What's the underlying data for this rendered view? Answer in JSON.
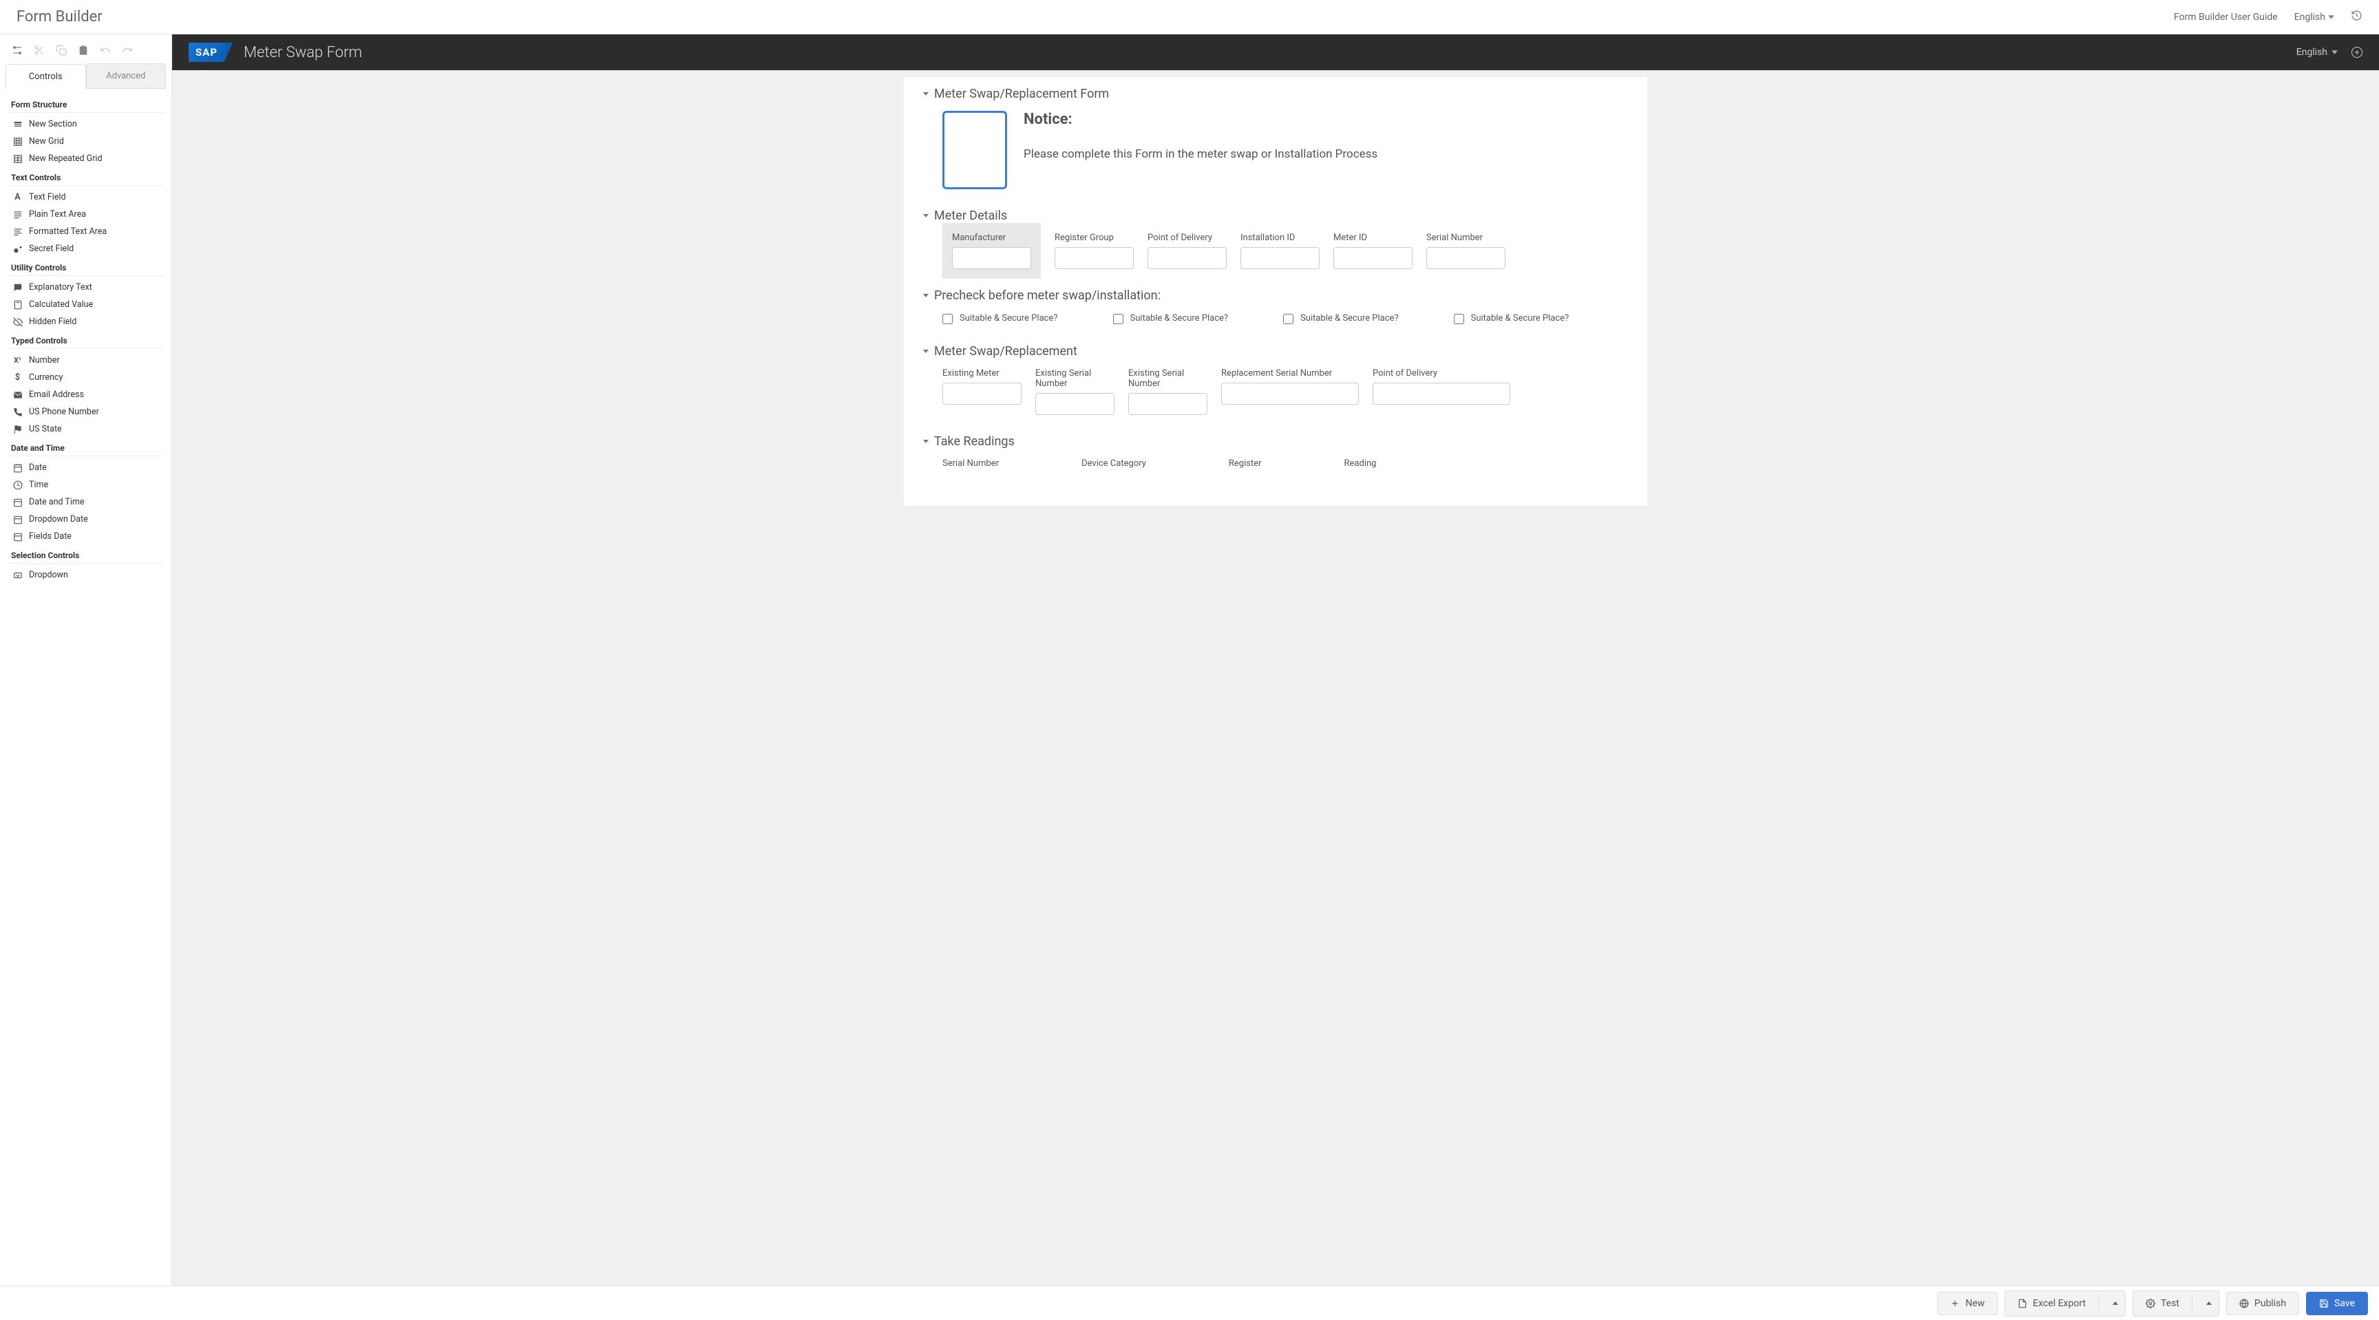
{
  "header": {
    "app_title": "Form Builder",
    "user_guide": "Form Builder User Guide",
    "language": "English"
  },
  "sidebar": {
    "tabs": {
      "controls": "Controls",
      "advanced": "Advanced"
    },
    "groups": [
      {
        "title": "Form Structure",
        "items": [
          "New Section",
          "New Grid",
          "New Repeated Grid"
        ]
      },
      {
        "title": "Text Controls",
        "items": [
          "Text Field",
          "Plain Text Area",
          "Formatted Text Area",
          "Secret Field"
        ]
      },
      {
        "title": "Utility Controls",
        "items": [
          "Explanatory Text",
          "Calculated Value",
          "Hidden Field"
        ]
      },
      {
        "title": "Typed Controls",
        "items": [
          "Number",
          "Currency",
          "Email Address",
          "US Phone Number",
          "US State"
        ]
      },
      {
        "title": "Date and Time",
        "items": [
          "Date",
          "Time",
          "Date and Time",
          "Dropdown Date",
          "Fields Date"
        ]
      },
      {
        "title": "Selection Controls",
        "items": [
          "Dropdown"
        ]
      }
    ]
  },
  "canvas": {
    "form_title": "Meter Swap Form",
    "language": "English",
    "sections": {
      "s1": {
        "title": "Meter Swap/Replacement Form",
        "notice_heading": "Notice:",
        "notice_body": "Please complete this Form in the meter swap or Installation Process"
      },
      "s2": {
        "title": "Meter Details",
        "fields": [
          "Manufacturer",
          "Register Group",
          "Point of Delivery",
          "Installation ID",
          "Meter ID",
          "Serial Number"
        ]
      },
      "s3": {
        "title": "Precheck before meter swap/installation:",
        "check_label": "Suitable & Secure Place?"
      },
      "s4": {
        "title": "Meter Swap/Replacement",
        "fields": [
          "Existing Meter",
          "Existing Serial Number",
          "Existing Serial Number",
          "Replacement Serial Number",
          "Point of Delivery"
        ]
      },
      "s5": {
        "title": "Take Readings",
        "fields": [
          "Serial Number",
          "Device Category",
          "Register",
          "Reading"
        ]
      }
    }
  },
  "footer": {
    "new": "New",
    "excel": "Excel Export",
    "test": "Test",
    "publish": "Publish",
    "save": "Save"
  }
}
